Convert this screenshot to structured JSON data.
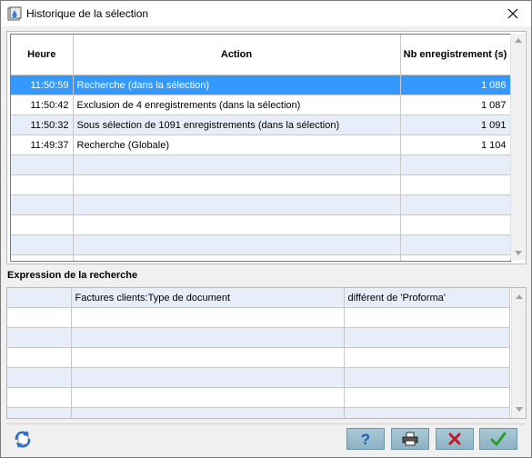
{
  "window": {
    "title": "Historique de la sélection"
  },
  "history": {
    "columns": [
      "Heure",
      "Action",
      "Nb enregistrement (s)"
    ],
    "rows": [
      {
        "time": "11:50:59",
        "action": "Recherche (dans la sélection)",
        "count": "1 086"
      },
      {
        "time": "11:50:42",
        "action": "Exclusion de 4 enregistrements (dans la sélection)",
        "count": "1 087"
      },
      {
        "time": "11:50:32",
        "action": "Sous sélection de 1091 enregistrements (dans la sélection)",
        "count": "1 091"
      },
      {
        "time": "11:49:37",
        "action": "Recherche (Globale)",
        "count": "1 104"
      }
    ],
    "selected_index": 0
  },
  "expression": {
    "label": "Expression de la recherche",
    "rows": [
      {
        "connector": "",
        "field": "Factures clients:Type de document",
        "condition": "différent de 'Proforma'"
      }
    ]
  },
  "footer": {
    "buttons": [
      {
        "name": "help-button",
        "icon": "question-icon",
        "color": "#1a5fb4"
      },
      {
        "name": "print-button",
        "icon": "printer-icon",
        "color": "#333333"
      },
      {
        "name": "cancel-button",
        "icon": "x-icon",
        "color": "#c01c28"
      },
      {
        "name": "ok-button",
        "icon": "checkmark-icon",
        "color": "#2a9d2a"
      }
    ]
  },
  "colors": {
    "selection": "#3399ff",
    "alt_row": "#e8eef9",
    "focus_border": "#1e90ff",
    "button_bg": "#9dbfce"
  }
}
